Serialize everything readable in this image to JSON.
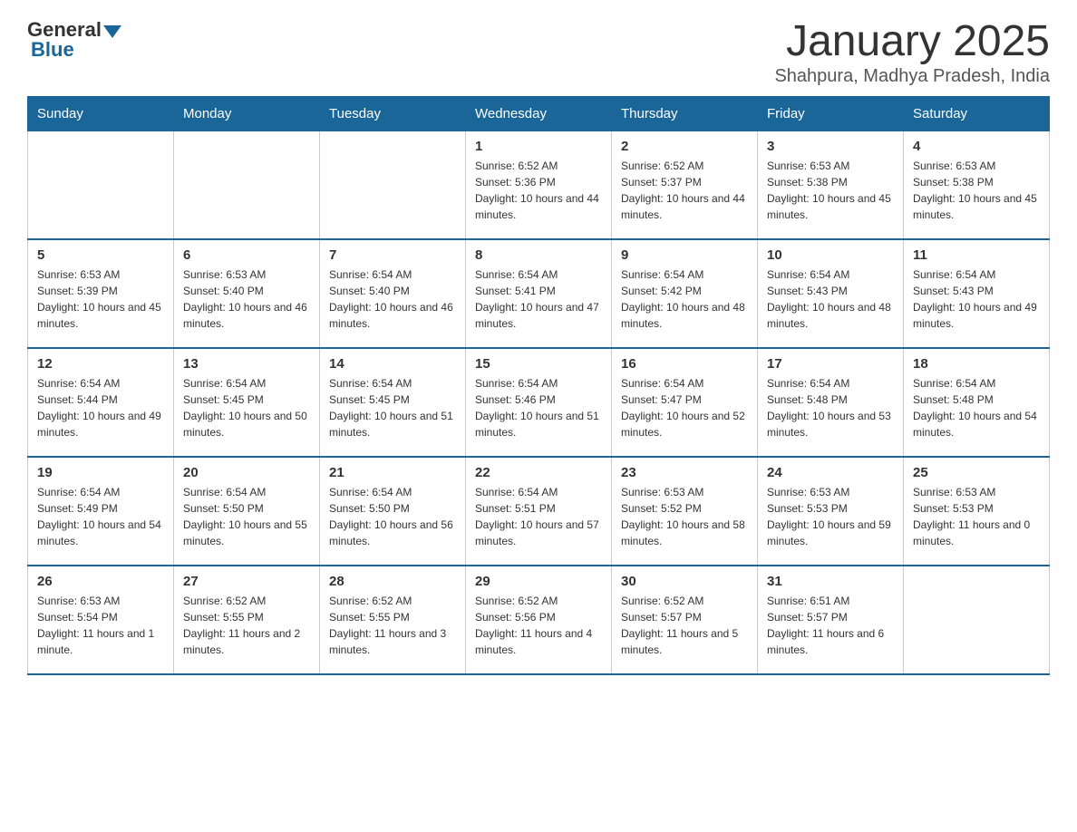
{
  "header": {
    "logo_general": "General",
    "logo_blue": "Blue",
    "title": "January 2025",
    "subtitle": "Shahpura, Madhya Pradesh, India"
  },
  "days_of_week": [
    "Sunday",
    "Monday",
    "Tuesday",
    "Wednesday",
    "Thursday",
    "Friday",
    "Saturday"
  ],
  "weeks": [
    [
      {
        "day": "",
        "info": ""
      },
      {
        "day": "",
        "info": ""
      },
      {
        "day": "",
        "info": ""
      },
      {
        "day": "1",
        "info": "Sunrise: 6:52 AM\nSunset: 5:36 PM\nDaylight: 10 hours and 44 minutes."
      },
      {
        "day": "2",
        "info": "Sunrise: 6:52 AM\nSunset: 5:37 PM\nDaylight: 10 hours and 44 minutes."
      },
      {
        "day": "3",
        "info": "Sunrise: 6:53 AM\nSunset: 5:38 PM\nDaylight: 10 hours and 45 minutes."
      },
      {
        "day": "4",
        "info": "Sunrise: 6:53 AM\nSunset: 5:38 PM\nDaylight: 10 hours and 45 minutes."
      }
    ],
    [
      {
        "day": "5",
        "info": "Sunrise: 6:53 AM\nSunset: 5:39 PM\nDaylight: 10 hours and 45 minutes."
      },
      {
        "day": "6",
        "info": "Sunrise: 6:53 AM\nSunset: 5:40 PM\nDaylight: 10 hours and 46 minutes."
      },
      {
        "day": "7",
        "info": "Sunrise: 6:54 AM\nSunset: 5:40 PM\nDaylight: 10 hours and 46 minutes."
      },
      {
        "day": "8",
        "info": "Sunrise: 6:54 AM\nSunset: 5:41 PM\nDaylight: 10 hours and 47 minutes."
      },
      {
        "day": "9",
        "info": "Sunrise: 6:54 AM\nSunset: 5:42 PM\nDaylight: 10 hours and 48 minutes."
      },
      {
        "day": "10",
        "info": "Sunrise: 6:54 AM\nSunset: 5:43 PM\nDaylight: 10 hours and 48 minutes."
      },
      {
        "day": "11",
        "info": "Sunrise: 6:54 AM\nSunset: 5:43 PM\nDaylight: 10 hours and 49 minutes."
      }
    ],
    [
      {
        "day": "12",
        "info": "Sunrise: 6:54 AM\nSunset: 5:44 PM\nDaylight: 10 hours and 49 minutes."
      },
      {
        "day": "13",
        "info": "Sunrise: 6:54 AM\nSunset: 5:45 PM\nDaylight: 10 hours and 50 minutes."
      },
      {
        "day": "14",
        "info": "Sunrise: 6:54 AM\nSunset: 5:45 PM\nDaylight: 10 hours and 51 minutes."
      },
      {
        "day": "15",
        "info": "Sunrise: 6:54 AM\nSunset: 5:46 PM\nDaylight: 10 hours and 51 minutes."
      },
      {
        "day": "16",
        "info": "Sunrise: 6:54 AM\nSunset: 5:47 PM\nDaylight: 10 hours and 52 minutes."
      },
      {
        "day": "17",
        "info": "Sunrise: 6:54 AM\nSunset: 5:48 PM\nDaylight: 10 hours and 53 minutes."
      },
      {
        "day": "18",
        "info": "Sunrise: 6:54 AM\nSunset: 5:48 PM\nDaylight: 10 hours and 54 minutes."
      }
    ],
    [
      {
        "day": "19",
        "info": "Sunrise: 6:54 AM\nSunset: 5:49 PM\nDaylight: 10 hours and 54 minutes."
      },
      {
        "day": "20",
        "info": "Sunrise: 6:54 AM\nSunset: 5:50 PM\nDaylight: 10 hours and 55 minutes."
      },
      {
        "day": "21",
        "info": "Sunrise: 6:54 AM\nSunset: 5:50 PM\nDaylight: 10 hours and 56 minutes."
      },
      {
        "day": "22",
        "info": "Sunrise: 6:54 AM\nSunset: 5:51 PM\nDaylight: 10 hours and 57 minutes."
      },
      {
        "day": "23",
        "info": "Sunrise: 6:53 AM\nSunset: 5:52 PM\nDaylight: 10 hours and 58 minutes."
      },
      {
        "day": "24",
        "info": "Sunrise: 6:53 AM\nSunset: 5:53 PM\nDaylight: 10 hours and 59 minutes."
      },
      {
        "day": "25",
        "info": "Sunrise: 6:53 AM\nSunset: 5:53 PM\nDaylight: 11 hours and 0 minutes."
      }
    ],
    [
      {
        "day": "26",
        "info": "Sunrise: 6:53 AM\nSunset: 5:54 PM\nDaylight: 11 hours and 1 minute."
      },
      {
        "day": "27",
        "info": "Sunrise: 6:52 AM\nSunset: 5:55 PM\nDaylight: 11 hours and 2 minutes."
      },
      {
        "day": "28",
        "info": "Sunrise: 6:52 AM\nSunset: 5:55 PM\nDaylight: 11 hours and 3 minutes."
      },
      {
        "day": "29",
        "info": "Sunrise: 6:52 AM\nSunset: 5:56 PM\nDaylight: 11 hours and 4 minutes."
      },
      {
        "day": "30",
        "info": "Sunrise: 6:52 AM\nSunset: 5:57 PM\nDaylight: 11 hours and 5 minutes."
      },
      {
        "day": "31",
        "info": "Sunrise: 6:51 AM\nSunset: 5:57 PM\nDaylight: 11 hours and 6 minutes."
      },
      {
        "day": "",
        "info": ""
      }
    ]
  ]
}
